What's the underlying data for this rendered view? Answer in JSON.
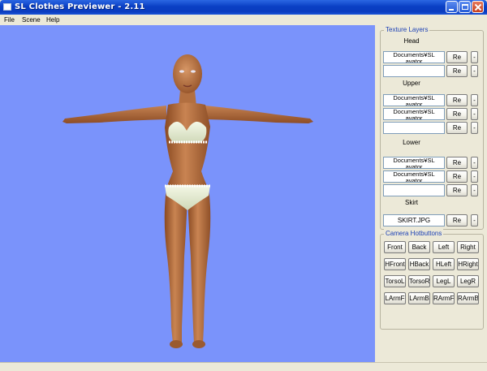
{
  "window": {
    "title": "SL Clothes Previewer - 2.11"
  },
  "menu": {
    "file": "File",
    "scene": "Scene",
    "help": "Help"
  },
  "colors": {
    "viewport_bg": "#7a93fb",
    "group_title": "#1a3fb5",
    "titlebar": "#0b3cbf"
  },
  "texture_layers": {
    "title": "Texture Layers",
    "head": {
      "label": "Head",
      "rows": [
        {
          "path_line1": "Documents¥SL",
          "path_line2": "avator",
          "re": "Re",
          "minus": "-"
        },
        {
          "path_line1": "",
          "path_line2": "",
          "re": "Re",
          "minus": "-"
        }
      ]
    },
    "upper": {
      "label": "Upper",
      "rows": [
        {
          "path_line1": "Documents¥SL",
          "path_line2": "avator",
          "re": "Re",
          "minus": "-"
        },
        {
          "path_line1": "Documents¥SL",
          "path_line2": "avator",
          "re": "Re",
          "minus": "-"
        },
        {
          "path_line1": "",
          "path_line2": "",
          "re": "Re",
          "minus": "-"
        }
      ]
    },
    "lower": {
      "label": "Lower",
      "rows": [
        {
          "path_line1": "Documents¥SL",
          "path_line2": "avator",
          "re": "Re",
          "minus": "-"
        },
        {
          "path_line1": "Documents¥SL",
          "path_line2": "avator",
          "re": "Re",
          "minus": "-"
        },
        {
          "path_line1": "",
          "path_line2": "",
          "re": "Re",
          "minus": "-"
        }
      ]
    },
    "skirt": {
      "label": "Skirt",
      "rows": [
        {
          "path_line1": "SKIRT.JPG",
          "path_line2": "",
          "re": "Re",
          "minus": "-"
        }
      ]
    }
  },
  "camera_hotbuttons": {
    "title": "Camera Hotbuttons",
    "buttons": [
      [
        "Front",
        "Back",
        "Left",
        "Right"
      ],
      [
        "HFront",
        "HBack",
        "HLeft",
        "HRight"
      ],
      [
        "TorsoL",
        "TorsoR",
        "LegL",
        "LegR"
      ],
      [
        "LArmF",
        "LArmB",
        "RArmF",
        "RArmB"
      ]
    ]
  }
}
